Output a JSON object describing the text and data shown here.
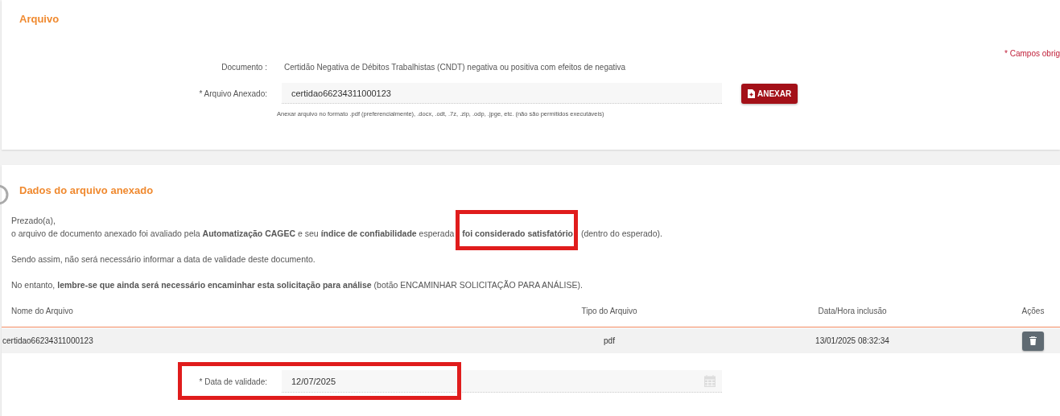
{
  "arquivo": {
    "title": "Arquivo",
    "required_note": "* Campos obrig",
    "document_label": "Documento :",
    "document_value": "Certidão Negativa de Débitos Trabalhistas (CNDT) negativa ou positiva com efeitos de negativa",
    "attachment_label": "* Arquivo Anexado:",
    "attachment_value": "certidao66234311000123",
    "attach_button": "ANEXAR",
    "hint": "Anexar arquivo no formato .pdf (preferencialmente), .docx, .odt, .7z, .zip, .odp, .jpge, etc. (não são permitidos executáveis)"
  },
  "dados": {
    "title": "Dados do arquivo anexado",
    "message": [
      "Prezado(a),",
      "o arquivo de documento anexado foi avaliado pela **Automatização CAGEC** e seu **índice de confiabilidade** esperada **foi considerado satisfatório** (dentro do esperado).",
      "Sendo assim, não será necessário informar a data de validade deste documento.",
      "No entanto, **lembre-se que ainda será necessário encaminhar esta solicitação para análise** (botão ENCAMINHAR SOLICITAÇÃO PARA ANÁLISE)."
    ],
    "table": {
      "columns": [
        "Nome do Arquivo",
        "Tipo do Arquivo",
        "Data/Hora inclusão",
        "Ações"
      ],
      "rows": [
        {
          "name": "certidao66234311000123",
          "type": "pdf",
          "datetime": "13/01/2025 08:32:34"
        }
      ]
    },
    "validity_label": "* Data de validade:",
    "validity_value": "12/07/2025",
    "message_highlighted": true,
    "validity_highlighted": true
  }
}
